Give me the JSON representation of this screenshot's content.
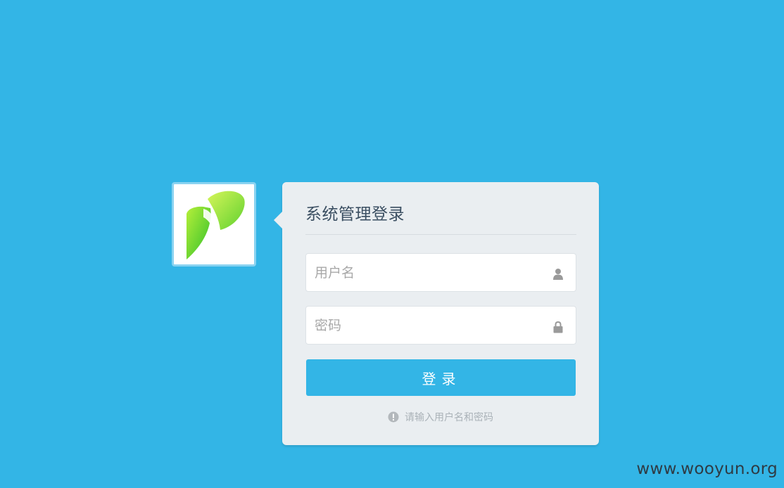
{
  "logo": {
    "icon": "leaf-p-logo-icon",
    "colors": [
      "#7ed321",
      "#3fbf2a"
    ]
  },
  "card": {
    "title": "系统管理登录",
    "background": "#eaeef1"
  },
  "form": {
    "username": {
      "placeholder": "用户名",
      "value": "",
      "icon": "user-icon"
    },
    "password": {
      "placeholder": "密码",
      "value": "",
      "icon": "lock-icon"
    },
    "submit_label": "登录",
    "hint_text": "请输入用户名和密码",
    "hint_icon": "info-icon"
  },
  "theme": {
    "page_background": "#33b5e6",
    "button_color": "#33b5e6"
  },
  "watermark": "www.wooyun.org"
}
